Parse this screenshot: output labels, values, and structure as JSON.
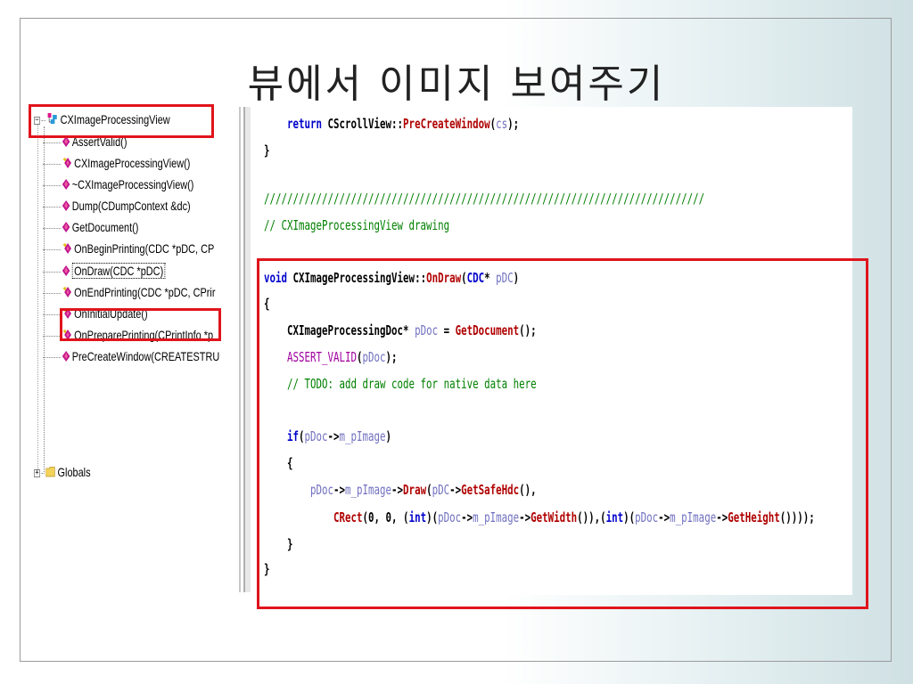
{
  "slide": {
    "title": "뷰에서 이미지 보여주기"
  },
  "class_tree": {
    "root_expander": "−",
    "root_label": "CXImageProcessingView",
    "members": [
      {
        "label": "AssertValid()",
        "icon": "method-icon"
      },
      {
        "label": "CXImageProcessingView()",
        "icon": "protected-method-icon"
      },
      {
        "label": "~CXImageProcessingView()",
        "icon": "method-icon"
      },
      {
        "label": "Dump(CDumpContext &dc)",
        "icon": "method-icon"
      },
      {
        "label": "GetDocument()",
        "icon": "method-icon"
      },
      {
        "label": "OnBeginPrinting(CDC *pDC, CP",
        "icon": "protected-method-icon"
      },
      {
        "label": "OnDraw(CDC *pDC)",
        "icon": "method-icon"
      },
      {
        "label": "OnEndPrinting(CDC *pDC, CPrir",
        "icon": "protected-method-icon"
      },
      {
        "label": "OnInitialUpdate()",
        "icon": "protected-method-icon"
      },
      {
        "label": "OnPreparePrinting(CPrintInfo *p",
        "icon": "protected-method-icon"
      },
      {
        "label": "PreCreateWindow(CREATESTRU",
        "icon": "method-icon"
      }
    ],
    "globals_expander": "+",
    "globals_label": "Globals"
  },
  "code": {
    "l1": {
      "indent": "    ",
      "kw": "return",
      "sp": " ",
      "cls": "CScrollView",
      "sep": "::",
      "fn": "PreCreateWindow",
      "open": "(",
      "arg": "cs",
      "close": ");"
    },
    "l2": "}",
    "l3": "////////////////////////////////////////////////////////////////////////////",
    "l4": "// CXImageProcessingView drawing",
    "l5": {
      "kw": "void",
      "sp": " ",
      "cls": "CXImageProcessingView",
      "sep": "::",
      "fn": "OnDraw",
      "open": "(",
      "ty": "CDC",
      "star": "* ",
      "arg": "pDC",
      "close": ")"
    },
    "l6": "{",
    "l7": {
      "indent": "    ",
      "ty": "CXImageProcessingDoc",
      "star": "* ",
      "var": "pDoc",
      "eq": " = ",
      "fn": "GetDocument",
      "close": "();"
    },
    "l8": {
      "indent": "    ",
      "mc": "ASSERT_VALID",
      "open": "(",
      "arg": "pDoc",
      "close": ");"
    },
    "l9": "    // TODO: add draw code for native data here",
    "l10": {
      "indent": "    ",
      "kw": "if",
      "open": "(",
      "var": "pDoc",
      "arrow": "->",
      "mem": "m_pImage",
      "close": ")"
    },
    "l11": "    {",
    "l12": {
      "indent": "        ",
      "var": "pDoc",
      "arrow": "->",
      "mem": "m_pImage",
      "arrow2": "->",
      "fn": "Draw",
      "open": "(",
      "arg": "pDC",
      "arrow3": "->",
      "fn2": "GetSafeHdc",
      "close": "(),"
    },
    "l13": {
      "indent": "            ",
      "fn": "CRect",
      "open": "(",
      "n1": "0",
      "c1": ", ",
      "n2": "0",
      "c2": ", ",
      "cast_open": "(",
      "kw": "int",
      "cast_close": ")",
      "p1": "(",
      "var": "pDoc",
      "arrow": "->",
      "mem": "m_pImage",
      "arrow2": "->",
      "fn2": "GetWidth",
      "p2": "()),",
      "cast2_open": "(",
      "kw2": "int",
      "cast2_close": ")",
      "p3": "(",
      "var2": "pDoc",
      "arrow3": "->",
      "mem2": "m_pImage",
      "arrow4": "->",
      "fn3": "GetHeight",
      "close": "())));"
    },
    "l14": "    }",
    "l15": "}"
  },
  "colors": {
    "highlight": "#e0141c",
    "keyword": "#0000cc",
    "function": "#b00000",
    "comment": "#008000",
    "macro": "#a000a0",
    "variable": "#7070c0"
  }
}
